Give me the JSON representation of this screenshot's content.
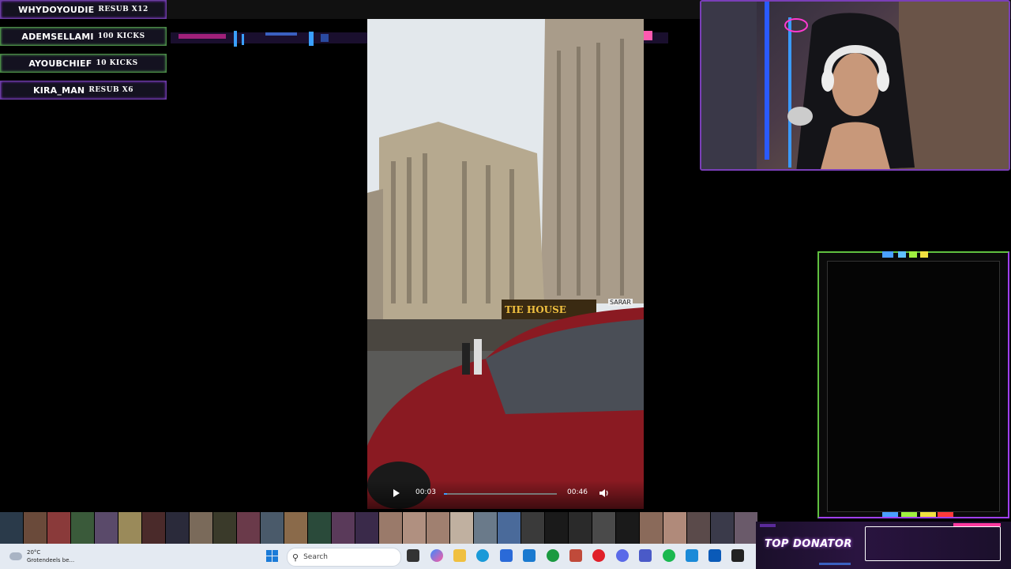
{
  "alerts": [
    {
      "name": "WHYDOYOUDIE",
      "event": "RESUB X12",
      "style": "purple"
    },
    {
      "name": "ADEMSELLAMI",
      "event": "100 KICKS",
      "style": "green"
    },
    {
      "name": "AYOUBCHIEF",
      "event": "10 KICKS",
      "style": "green"
    },
    {
      "name": "KIRA_MAN",
      "event": "RESUB X6",
      "style": "purple"
    }
  ],
  "video": {
    "sign_text": "TIE HOUSE",
    "sign_text_2": "SARAR",
    "current_time": "00:03",
    "duration": "00:46",
    "progress": 0.03
  },
  "taskbar": {
    "temperature": "20°C",
    "weather_desc": "Grotendeels be...",
    "search_placeholder": "Search",
    "icons": [
      "task-view-icon",
      "copilot-icon",
      "file-explorer-icon",
      "edge-icon",
      "store-icon",
      "mail-icon",
      "xbox-icon",
      "sticky-notes-icon",
      "opera-icon",
      "discord-icon",
      "teams-icon",
      "spotify-icon",
      "remote-desktop-icon",
      "outlook-icon",
      "capcut-icon"
    ]
  },
  "donator": {
    "title": "TOP DONATOR"
  },
  "colors": {
    "accent_purple": "#7a3fb8",
    "accent_green": "#60c040",
    "seek": "#3aa0ff",
    "taskbar": "#e4eaf2"
  }
}
